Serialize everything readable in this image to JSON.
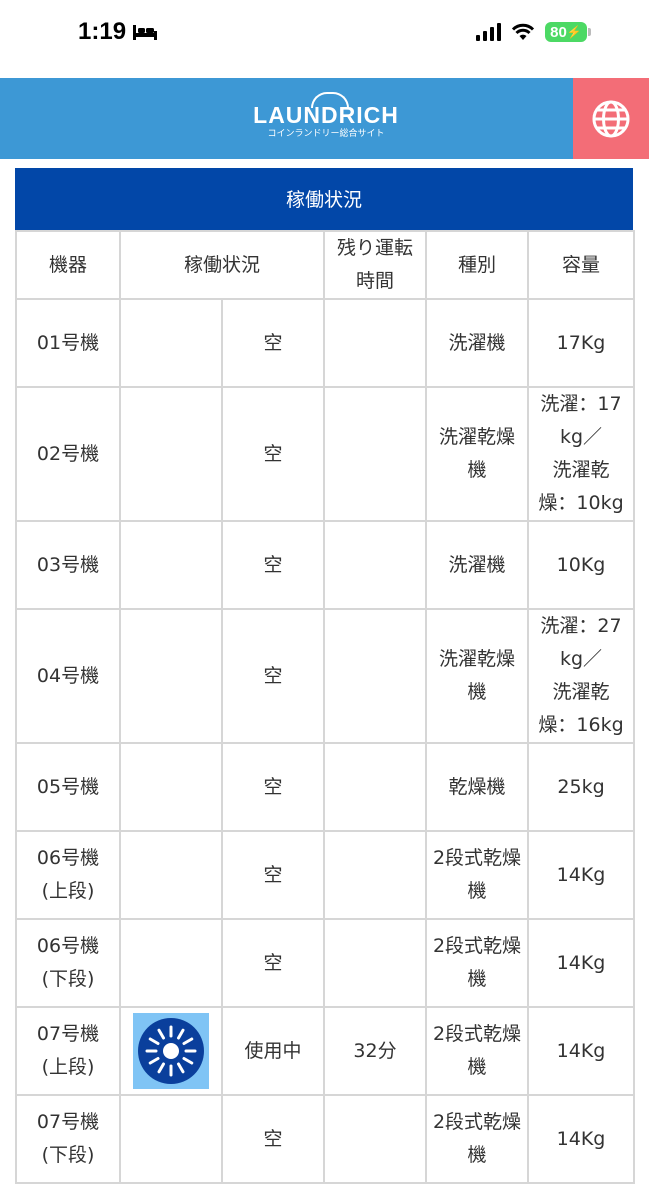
{
  "status_bar": {
    "time": "1:19",
    "battery": "80"
  },
  "header": {
    "logo_main": "LAUNDRICH",
    "logo_sub": "コインランドリー総合サイト",
    "globe_icon": "globe-icon"
  },
  "table": {
    "title": "稼働状況",
    "headers": [
      "機器",
      "稼働状況",
      "残り運転時間",
      "種別",
      "容量"
    ],
    "header_time_lines": [
      "残り運転",
      "時間"
    ],
    "rows": [
      {
        "machine": [
          "01号機"
        ],
        "status": "空",
        "remaining": "",
        "type": [
          "洗濯機"
        ],
        "capacity": [
          "17Kg"
        ],
        "icon": ""
      },
      {
        "machine": [
          "02号機"
        ],
        "status": "空",
        "remaining": "",
        "type": [
          "洗濯乾燥",
          "機"
        ],
        "capacity": [
          "洗濯：17",
          "kg／",
          "洗濯乾",
          "燥：10kg"
        ],
        "icon": ""
      },
      {
        "machine": [
          "03号機"
        ],
        "status": "空",
        "remaining": "",
        "type": [
          "洗濯機"
        ],
        "capacity": [
          "10Kg"
        ],
        "icon": ""
      },
      {
        "machine": [
          "04号機"
        ],
        "status": "空",
        "remaining": "",
        "type": [
          "洗濯乾燥",
          "機"
        ],
        "capacity": [
          "洗濯：27",
          "kg／",
          "洗濯乾",
          "燥：16kg"
        ],
        "icon": ""
      },
      {
        "machine": [
          "05号機"
        ],
        "status": "空",
        "remaining": "",
        "type": [
          "乾燥機"
        ],
        "capacity": [
          "25kg"
        ],
        "icon": ""
      },
      {
        "machine": [
          "06号機",
          "(上段)"
        ],
        "status": "空",
        "remaining": "",
        "type": [
          "2段式乾燥",
          "機"
        ],
        "capacity": [
          "14Kg"
        ],
        "icon": ""
      },
      {
        "machine": [
          "06号機",
          "(下段)"
        ],
        "status": "空",
        "remaining": "",
        "type": [
          "2段式乾燥",
          "機"
        ],
        "capacity": [
          "14Kg"
        ],
        "icon": ""
      },
      {
        "machine": [
          "07号機",
          "(上段)"
        ],
        "status": "使用中",
        "remaining": "32分",
        "type": [
          "2段式乾燥",
          "機"
        ],
        "capacity": [
          "14Kg"
        ],
        "icon": "drum-spinning-icon"
      },
      {
        "machine": [
          "07号機",
          "(下段)"
        ],
        "status": "空",
        "remaining": "",
        "type": [
          "2段式乾燥",
          "機"
        ],
        "capacity": [
          "14Kg"
        ],
        "icon": ""
      }
    ]
  },
  "colors": {
    "header_bg": "#3d98d5",
    "globe_bg": "#f36d77",
    "table_title_bg": "#0247a8",
    "battery": "#4cd964",
    "drum_icon": "#0a3f9c"
  }
}
